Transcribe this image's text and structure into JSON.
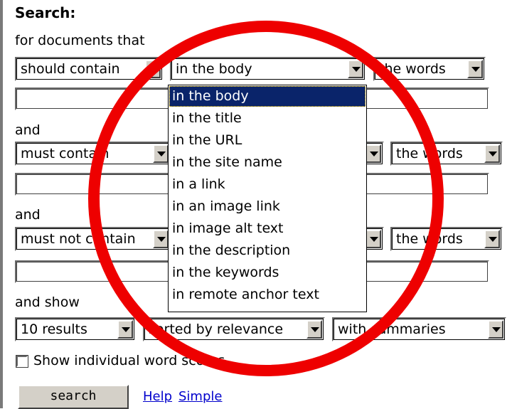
{
  "form": {
    "heading": "Search:",
    "intro": "for documents that",
    "row1": {
      "contain": "should contain",
      "location": "in the body",
      "words": "the words"
    },
    "and1": "and",
    "row2": {
      "contain": "must contain",
      "words": "the words"
    },
    "and2": "and",
    "row3": {
      "contain": "must not contain",
      "words": "the words"
    },
    "and_show": "and show",
    "results": {
      "count": "10 results",
      "sort": "sorted by relevance",
      "summaries": "with summaries"
    },
    "show_scores_label": "Show individual word scores",
    "search_button": "search",
    "help_link": "Help",
    "simple_link": "Simple"
  },
  "location_dropdown": {
    "selected": "in the body",
    "options": [
      "in the body",
      "in the title",
      "in the URL",
      "in the site name",
      "in a link",
      "in an image link",
      "in image alt text",
      "in the description",
      "in the keywords",
      "in remote anchor text"
    ]
  },
  "colors": {
    "highlight": "#0a246a",
    "annotation_circle": "#ee0000",
    "link": "#0000cc"
  }
}
